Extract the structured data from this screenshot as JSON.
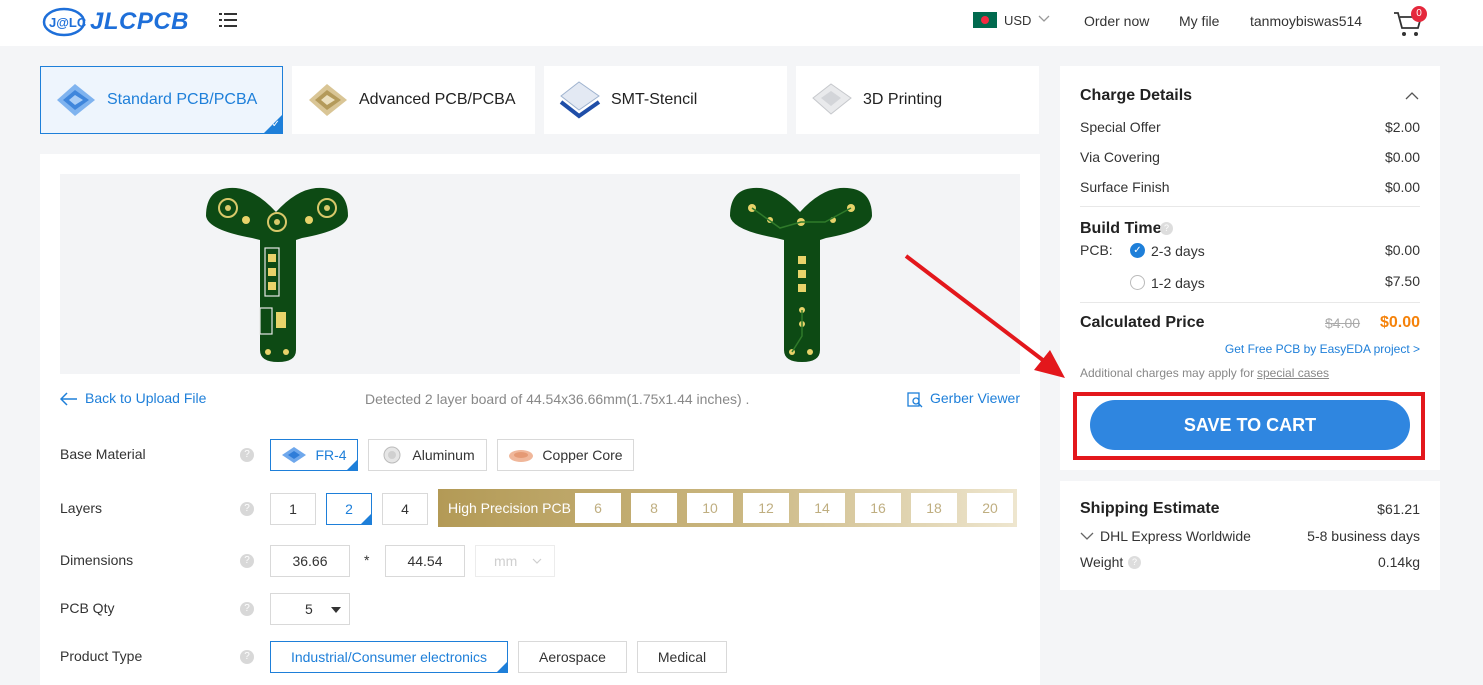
{
  "header": {
    "logo_text": "JLCPCB",
    "currency": "USD",
    "order_now": "Order now",
    "my_file": "My file",
    "username": "tanmoybiswas514",
    "cart_count": "0"
  },
  "categories": [
    {
      "label": "Standard PCB/PCBA",
      "active": true
    },
    {
      "label": "Advanced PCB/PCBA",
      "active": false
    },
    {
      "label": "SMT-Stencil",
      "active": false
    },
    {
      "label": "3D Printing",
      "active": false
    }
  ],
  "upload": {
    "back_link": "Back to Upload File",
    "detected": "Detected 2 layer board of 44.54x36.66mm(1.75x1.44 inches) .",
    "gerber_viewer": "Gerber Viewer"
  },
  "form": {
    "base_material": {
      "label": "Base Material",
      "options": [
        "FR-4",
        "Aluminum",
        "Copper Core"
      ],
      "selected": "FR-4"
    },
    "layers": {
      "label": "Layers",
      "options": [
        "1",
        "2",
        "4"
      ],
      "selected": "2",
      "high_precision_label": "High Precision PCB",
      "high_precision_options": [
        "6",
        "8",
        "10",
        "12",
        "14",
        "16",
        "18",
        "20"
      ]
    },
    "dimensions": {
      "label": "Dimensions",
      "width": "36.66",
      "separator": "*",
      "height": "44.54",
      "unit": "mm"
    },
    "pcb_qty": {
      "label": "PCB Qty",
      "value": "5"
    },
    "product_type": {
      "label": "Product Type",
      "options": [
        "Industrial/Consumer electronics",
        "Aerospace",
        "Medical"
      ],
      "selected": "Industrial/Consumer electronics"
    },
    "help_mark": "?"
  },
  "charges": {
    "title": "Charge Details",
    "rows": [
      {
        "label": "Special Offer",
        "value": "$2.00"
      },
      {
        "label": "Via Covering",
        "value": "$0.00"
      },
      {
        "label": "Surface Finish",
        "value": "$0.00"
      }
    ],
    "build_time_title": "Build Time",
    "pcb_label": "PCB:",
    "build_options": [
      {
        "label": "2-3 days",
        "value": "$0.00",
        "checked": true
      },
      {
        "label": "1-2 days",
        "value": "$7.50",
        "checked": false
      }
    ],
    "calculated_label": "Calculated Price",
    "old_price": "$4.00",
    "new_price": "$0.00",
    "free_pcb_link": "Get Free PCB by EasyEDA project >",
    "additional_note": "Additional charges may apply for",
    "special_cases": "special cases",
    "save_button": "SAVE TO CART"
  },
  "shipping": {
    "title": "Shipping Estimate",
    "price": "$61.21",
    "method": "DHL Express Worldwide",
    "duration": "5-8 business days",
    "weight_label": "Weight",
    "weight_value": "0.14kg"
  },
  "colors": {
    "accent": "#1e7fd9",
    "button": "#2f86e0",
    "highlight_red": "#e3171c",
    "price_orange": "#f5820a",
    "pcb_green": "#0d4a14"
  }
}
